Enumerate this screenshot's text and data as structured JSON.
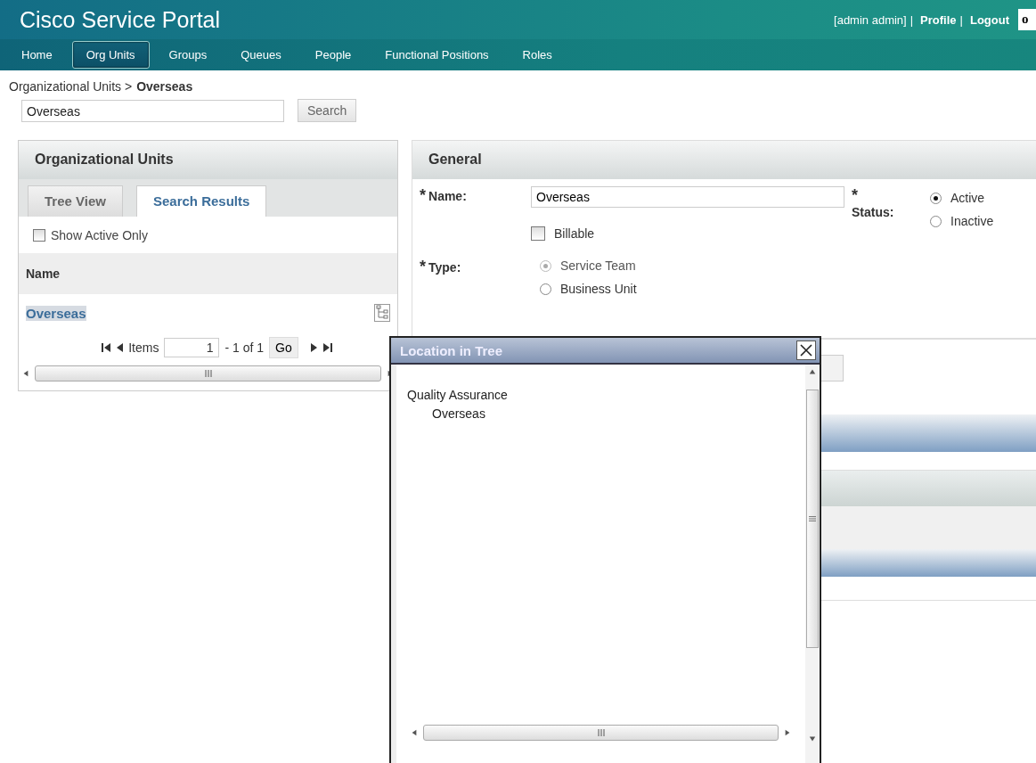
{
  "header": {
    "title": "Cisco Service Portal",
    "user": "[admin admin]",
    "separator": "|",
    "links": [
      "Profile",
      "Logout"
    ],
    "search_value": "o"
  },
  "nav": [
    {
      "label": "Home",
      "selected": false
    },
    {
      "label": "Org Units",
      "selected": true
    },
    {
      "label": "Groups",
      "selected": false
    },
    {
      "label": "Queues",
      "selected": false
    },
    {
      "label": "People",
      "selected": false
    },
    {
      "label": "Functional Positions",
      "selected": false
    },
    {
      "label": "Roles",
      "selected": false
    }
  ],
  "breadcrumb": {
    "parent": "Organizational Units >",
    "current": "Overseas"
  },
  "search": {
    "value": "Overseas",
    "button": "Search"
  },
  "org_panel": {
    "title": "Organizational Units",
    "tabs": [
      {
        "label": "Tree View",
        "selected": false
      },
      {
        "label": "Search Results",
        "selected": true
      }
    ],
    "show_active_only": {
      "label": "Show Active Only",
      "checked": false
    },
    "column": "Name",
    "rows": [
      {
        "name": "Overseas",
        "selected": true
      }
    ],
    "pager": {
      "label": "Items",
      "value": "1",
      "range": "- 1  of 1",
      "go": "Go"
    }
  },
  "general": {
    "title": "General",
    "required_mark": "*",
    "name": {
      "label": "Name:",
      "value": "Overseas"
    },
    "status": {
      "label": "Status:",
      "options": [
        {
          "label": "Active",
          "selected": true
        },
        {
          "label": "Inactive",
          "selected": false
        }
      ]
    },
    "billable": {
      "label": "Billable",
      "checked": false
    },
    "type": {
      "label": "Type:",
      "options": [
        {
          "label": "Service Team",
          "selected": true,
          "disabled": true
        },
        {
          "label": "Business Unit",
          "selected": false,
          "disabled": false
        }
      ]
    }
  },
  "popup": {
    "title": "Location in Tree",
    "tree": [
      {
        "label": "Quality Assurance",
        "children": [
          {
            "label": "Overseas"
          }
        ]
      }
    ]
  }
}
